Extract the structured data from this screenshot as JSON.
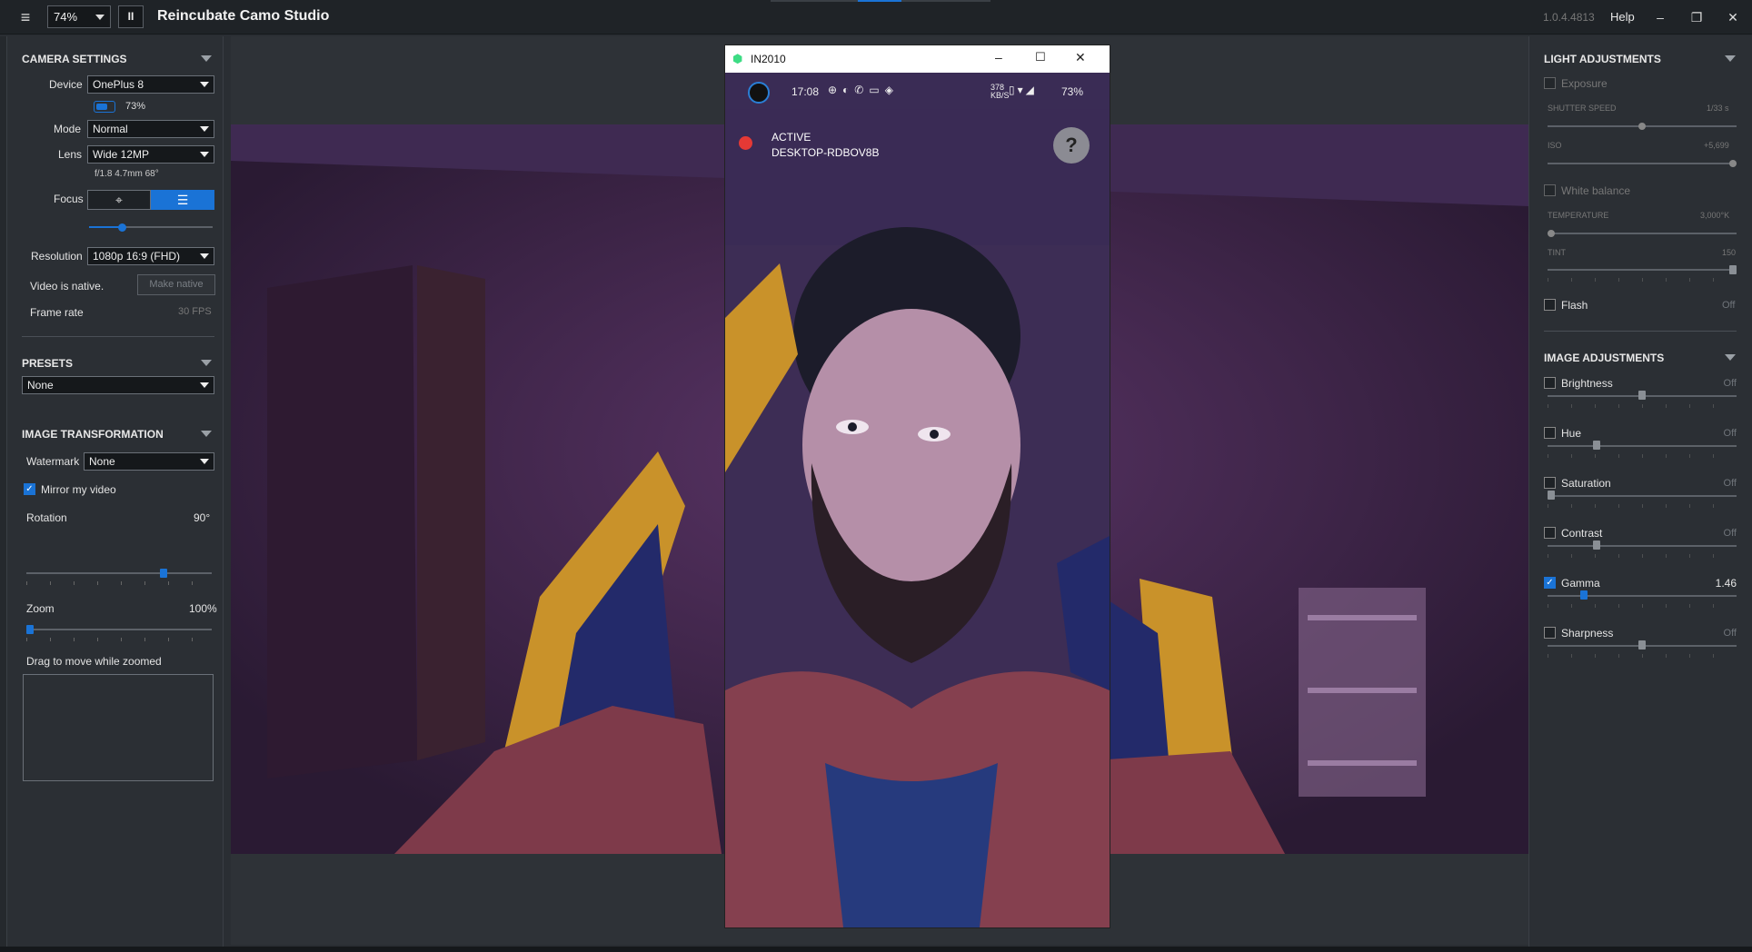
{
  "app": {
    "title": "Reincubate Camo Studio",
    "zoom": "74%",
    "pause_label": "II",
    "version": "1.0.4.4813",
    "help": "Help"
  },
  "camera": {
    "title": "CAMERA SETTINGS",
    "device_label": "Device",
    "device": "OnePlus 8",
    "battery": "73%",
    "mode_label": "Mode",
    "mode": "Normal",
    "lens_label": "Lens",
    "lens": "Wide 12MP",
    "lens_info": "f/1.8 4.7mm 68°",
    "focus_label": "Focus",
    "resolution_label": "Resolution",
    "resolution": "1080p 16:9 (FHD)",
    "native_text": "Video is native.",
    "make_native": "Make native",
    "framerate_label": "Frame rate",
    "framerate": "30 FPS"
  },
  "presets": {
    "title": "PRESETS",
    "value": "None"
  },
  "transform": {
    "title": "IMAGE TRANSFORMATION",
    "watermark_label": "Watermark",
    "watermark": "None",
    "mirror_label": "Mirror my video",
    "rotation_label": "Rotation",
    "rotation": "90°",
    "zoom_label": "Zoom",
    "zoom": "100%",
    "drag_label": "Drag to move while zoomed"
  },
  "light": {
    "title": "LIGHT ADJUSTMENTS",
    "exposure": "Exposure",
    "shutter_label": "SHUTTER SPEED",
    "shutter": "1/33 s",
    "iso_label": "ISO",
    "iso": "+5,699",
    "wb": "White balance",
    "temp_label": "TEMPERATURE",
    "temp": "3,000°K",
    "tint_label": "TINT",
    "tint": "150",
    "flash": "Flash",
    "flash_state": "Off"
  },
  "image": {
    "title": "IMAGE ADJUSTMENTS",
    "items": [
      {
        "label": "Brightness",
        "value": "Off",
        "checked": false,
        "level": 0.5
      },
      {
        "label": "Hue",
        "value": "Off",
        "checked": false,
        "level": 0.25
      },
      {
        "label": "Saturation",
        "value": "Off",
        "checked": false,
        "level": 0.0
      },
      {
        "label": "Contrast",
        "value": "Off",
        "checked": false,
        "level": 0.25
      },
      {
        "label": "Gamma",
        "value": "1.46",
        "checked": true,
        "level": 0.18
      },
      {
        "label": "Sharpness",
        "value": "Off",
        "checked": false,
        "level": 0.5
      }
    ]
  },
  "phone": {
    "window_title": "IN2010",
    "time": "17:08",
    "battery": "73%",
    "net": "378\nKB/S",
    "status": "ACTIVE",
    "host": "DESKTOP-RDBOV8B",
    "help": "?"
  },
  "levels": {
    "focus": 0.25,
    "rotation": 0.75,
    "zoom": 0.0,
    "shutter": 0.5,
    "iso": 1.0,
    "temp": 0.0,
    "tint": 1.0
  }
}
